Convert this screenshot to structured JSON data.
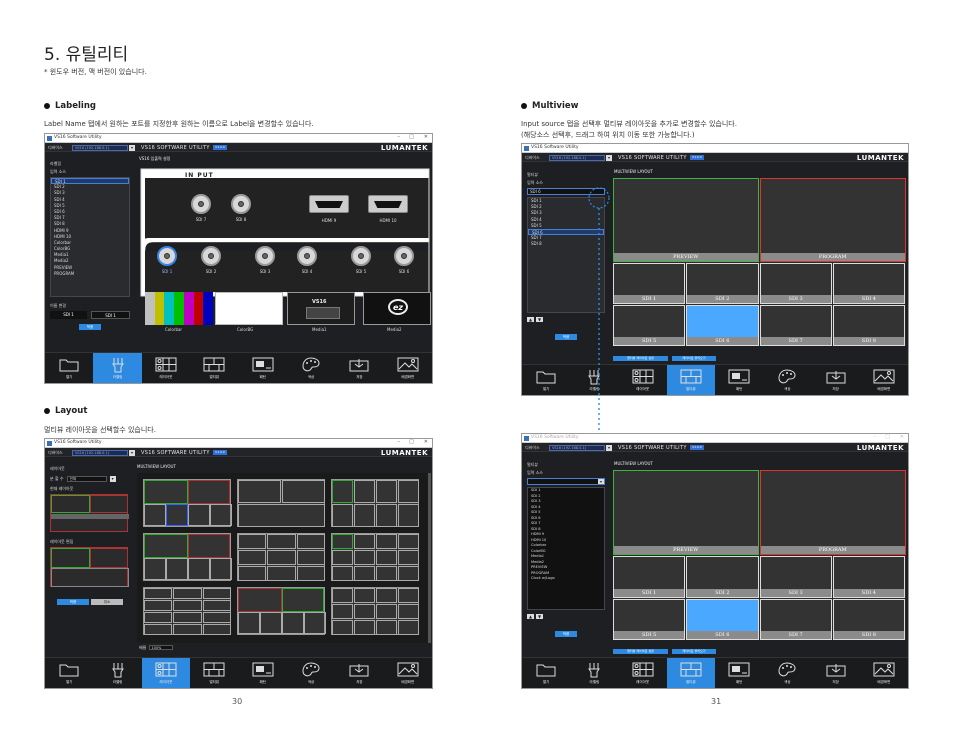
{
  "page": {
    "title": "5. 유틸리티",
    "note": "* 윈도우 버전, 맥 버전이 있습니다.",
    "page_left": "30",
    "page_right": "31"
  },
  "sections": {
    "labeling": {
      "title": "Labeling",
      "desc": "Label Name 탭에서 원하는 포트를 지정한후 원하는 이름으로 Label을 변경할수 있습니다."
    },
    "multiview": {
      "title": "Multiview",
      "desc_line1": "Input source 탭을 선택후 멀티뷰 레이아웃을 추가로 변경할수 있습니다.",
      "desc_line2": "(해당소스 선택후, 드래그 하여 위치 이동 또한 가능합니다.)"
    },
    "layout": {
      "title": "Layout",
      "desc": "멀티뷰 레이아웃을 선택할수 있습니다."
    }
  },
  "app": {
    "window_title": "VS16 Software Utility",
    "window_controls": [
      "–",
      "□",
      "✕"
    ],
    "device_label": "디바이스",
    "device_value": "VS16 (192.168.0.1)",
    "software_title": "VS16 SOFTWARE UTILITY",
    "version_badge": "V1.0.0",
    "brand": "LUMANTEK",
    "toolbar": [
      "열기",
      "라벨링",
      "레이아웃",
      "멀티뷰",
      "패턴",
      "색상",
      "저장",
      "배경화면"
    ]
  },
  "labeling_win": {
    "side_header": "라벨링",
    "list_header": "입력 소스",
    "items": [
      "SDI 1",
      "SDI 2",
      "SDI 3",
      "SDI 4",
      "SDI 5",
      "SDI 6",
      "SDI 7",
      "SDI 8",
      "HDMI 9",
      "HDMI 10",
      "Colorbar",
      "ColorBG",
      "Media1",
      "Media2",
      "PREVIEW",
      "PROGRAM"
    ],
    "rename_header": "이름 변경",
    "rename_from": "SDI 1",
    "rename_to": "SDI 1",
    "apply": "적용",
    "main_header": "VS16 입출력 설정",
    "input_title": "IN PUT",
    "top_ports": [
      "SDI 7",
      "SDI 8",
      "HDMI 9",
      "HDMI 10"
    ],
    "bottom_ports": [
      "SDI 1",
      "SDI 2",
      "SDI 3",
      "SDI 4",
      "SDI 5",
      "SDI 6"
    ],
    "media": [
      "Colorbar",
      "ColorBG",
      "Media1",
      "Media2"
    ],
    "media1_logo": "VS16",
    "media2_logo": "ez"
  },
  "multiview_win": {
    "side_header": "멀티뷰",
    "list_header": "입력 소스",
    "selected": "SDI 6",
    "items": [
      "SDI 1",
      "SDI 2",
      "SDI 3",
      "SDI 4",
      "SDI 5",
      "SDI 6",
      "SDI 7",
      "SDI 8"
    ],
    "main_header": "MULTIVIEW LAYOUT",
    "big": [
      "PREVIEW",
      "PROGRAM"
    ],
    "row1": [
      "SDI 1",
      "SDI 2",
      "SDI 3",
      "SDI 4"
    ],
    "row2": [
      "SDI 5",
      "SDI 6",
      "SDI 7",
      "SDI 8"
    ],
    "apply": "적용",
    "bottom_a": "멀티뷰 레이아웃 설정",
    "bottom_b": "레이아웃 불러오기"
  },
  "multiview_win2": {
    "items": [
      "SDI 1",
      "SDI 2",
      "SDI 3",
      "SDI 4",
      "SDI 5",
      "SDI 6",
      "SDI 7",
      "SDI 8",
      "HDMI 9",
      "HDMI 10",
      "Colorbar",
      "ColorBG",
      "Media1",
      "Media2",
      "PREVIEW",
      "PROGRAM",
      "Clock w/Logo"
    ]
  },
  "layout_win": {
    "side_header": "레이아웃",
    "mode_label": "분 할 수",
    "mode_value": "전체",
    "preview_label": "현재 레이아웃",
    "custom_label": "레이아웃 편집",
    "apply": "적용",
    "cancel": "취소",
    "main_header": "MULTIVIEW LAYOUT",
    "zoom_label": "배율",
    "zoom_value": "100%"
  }
}
